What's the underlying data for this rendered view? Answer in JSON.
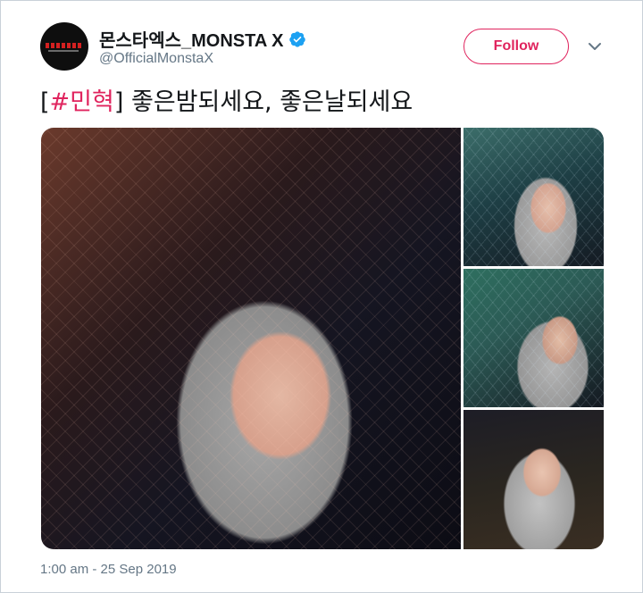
{
  "user": {
    "display_name": "몬스타엑스_MONSTA X",
    "handle": "@OfficialMonstaX",
    "verified": true,
    "verified_icon": "verified-badge-icon",
    "avatar": "monsta-x-logo-avatar"
  },
  "actions": {
    "follow_label": "Follow",
    "menu_icon": "chevron-down-icon"
  },
  "tweet": {
    "bracket_open": "[",
    "hashtag": "#민혁",
    "bracket_close": "]",
    "body": " 좋은밤되세요, 좋은날되세요"
  },
  "media": {
    "photo_count": 4,
    "photos": [
      "selfie-photo-main",
      "selfie-photo-2",
      "selfie-photo-3",
      "selfie-photo-4"
    ]
  },
  "meta": {
    "timestamp": "1:00 am - 25 Sep 2019"
  },
  "colors": {
    "accent": "#e0245e",
    "verified": "#1da1f2",
    "secondary_text": "#657786",
    "primary_text": "#14171a",
    "border": "#c9d1d8"
  }
}
